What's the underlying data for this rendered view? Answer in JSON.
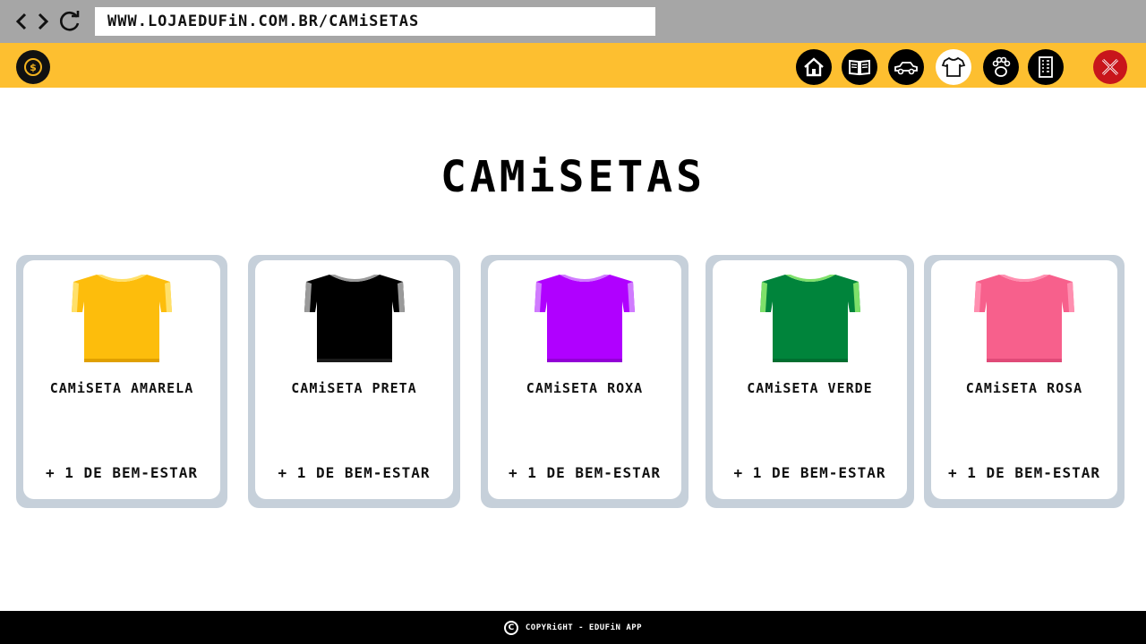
{
  "browser": {
    "url": "WWW.LOJAEDUFiN.COM.BR/CAMiSETAS"
  },
  "header": {
    "logo_icon": "coin-logo-icon",
    "nav_icons": [
      "home-icon",
      "book-icon",
      "car-icon",
      "tshirt-icon",
      "paw-icon",
      "building-icon",
      "close-icon"
    ],
    "active": "tshirt-icon",
    "colors": {
      "bar": "#fdbf30",
      "icon_bg": "#000000",
      "active_bg": "#ffffff",
      "close_bg": "#c8151b"
    }
  },
  "page": {
    "title": "CAMiSETAS"
  },
  "products": [
    {
      "name": "CAMiSETA AMARELA",
      "bonus": "+ 1 DE BEM-ESTAR",
      "color": "#fdbd0c",
      "shade": "#e0a000",
      "collar": "#ffe06a"
    },
    {
      "name": "CAMiSETA PRETA",
      "bonus": "+ 1 DE BEM-ESTAR",
      "color": "#000000",
      "shade": "#1a1a1a",
      "collar": "#9a9a9a"
    },
    {
      "name": "CAMiSETA ROXA",
      "bonus": "+ 1 DE BEM-ESTAR",
      "color": "#b000ff",
      "shade": "#9200d6",
      "collar": "#d07bff"
    },
    {
      "name": "CAMiSETA VERDE",
      "bonus": "+ 1 DE BEM-ESTAR",
      "color": "#00843b",
      "shade": "#006e30",
      "collar": "#7ee06a"
    },
    {
      "name": "CAMiSETA ROSA",
      "bonus": "+ 1 DE BEM-ESTAR",
      "color": "#f7608c",
      "shade": "#e04a78",
      "collar": "#ff8fb0"
    }
  ],
  "footer": {
    "text": "COPYRiGHT - EDUFiN APP",
    "icon": "copyright-icon"
  }
}
